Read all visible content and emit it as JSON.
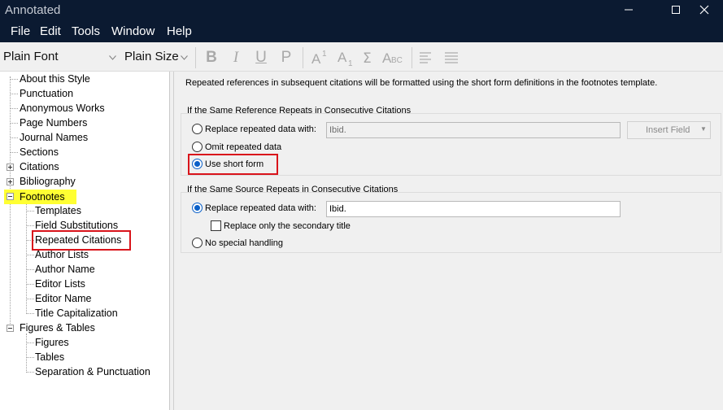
{
  "window": {
    "title": "Annotated"
  },
  "menu": [
    "File",
    "Edit",
    "Tools",
    "Window",
    "Help"
  ],
  "toolbar": {
    "font_value": "Plain Font",
    "size_value": "Plain Size"
  },
  "tree": {
    "about": "About this Style",
    "punctuation": "Punctuation",
    "anonymous": "Anonymous Works",
    "page_numbers": "Page Numbers",
    "journal_names": "Journal Names",
    "sections": "Sections",
    "citations": "Citations",
    "bibliography": "Bibliography",
    "footnotes": "Footnotes",
    "templates": "Templates",
    "field_subs": "Field Substitutions",
    "repeated": "Repeated Citations",
    "author_lists": "Author Lists",
    "author_name": "Author Name",
    "editor_lists": "Editor Lists",
    "editor_name": "Editor Name",
    "title_cap": "Title Capitalization",
    "figures_tables": "Figures & Tables",
    "figures": "Figures",
    "tables": "Tables",
    "separation": "Separation & Punctuation"
  },
  "panel": {
    "intro": "Repeated references in subsequent citations will be formatted using the short form definitions in the footnotes template.",
    "group1": {
      "title": "If the Same Reference Repeats in Consecutive Citations",
      "replace_label": "Replace repeated data with:",
      "replace_value": "Ibid.",
      "insert_field": "Insert Field",
      "omit_label": "Omit repeated data",
      "short_label": "Use short form"
    },
    "group2": {
      "title": "If the Same Source Repeats in Consecutive Citations",
      "replace_label": "Replace repeated data with:",
      "replace_value": "Ibid.",
      "secondary_label": "Replace only the secondary title",
      "none_label": "No special handling"
    }
  },
  "colors": {
    "titlebar": "#0b1a31",
    "highlight": "#ffff33",
    "annotation": "#d9141b",
    "radio_selected": "#0a60c8"
  }
}
